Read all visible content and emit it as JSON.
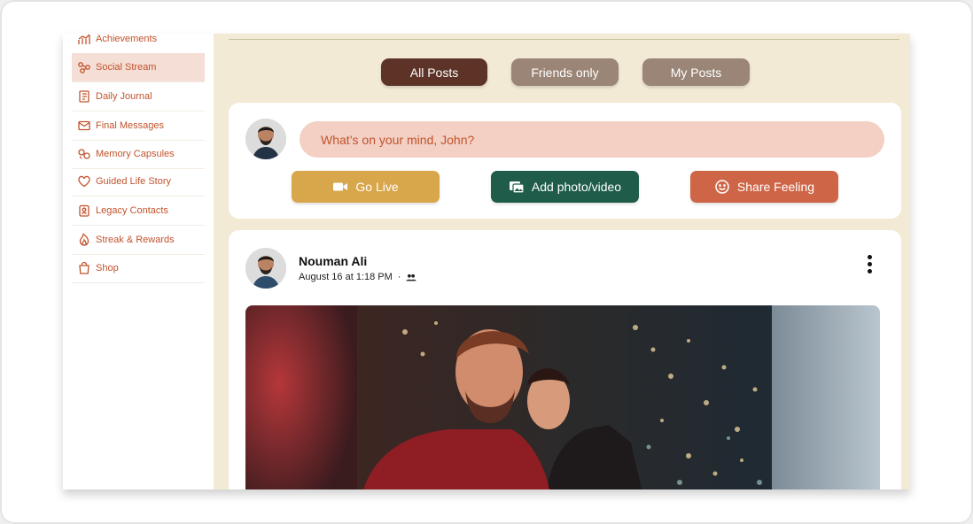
{
  "sidebar": {
    "items": [
      {
        "label": "Achievements",
        "icon": "chart-icon",
        "active": false
      },
      {
        "label": "Social Stream",
        "icon": "network-icon",
        "active": true
      },
      {
        "label": "Daily Journal",
        "icon": "journal-icon",
        "active": false
      },
      {
        "label": "Final Messages",
        "icon": "envelope-icon",
        "active": false
      },
      {
        "label": "Memory Capsules",
        "icon": "capsules-icon",
        "active": false
      },
      {
        "label": "Guided Life Story",
        "icon": "heart-icon",
        "active": false
      },
      {
        "label": "Legacy Contacts",
        "icon": "contact-badge-icon",
        "active": false
      },
      {
        "label": "Streak & Rewards",
        "icon": "flame-icon",
        "active": false
      },
      {
        "label": "Shop",
        "icon": "shopping-bag-icon",
        "active": false
      }
    ]
  },
  "tabs": [
    {
      "label": "All Posts",
      "active": true
    },
    {
      "label": "Friends only",
      "active": false
    },
    {
      "label": "My Posts",
      "active": false
    }
  ],
  "composer": {
    "placeholder": "What’s on your mind, John?",
    "actions": [
      {
        "label": "Go Live",
        "icon": "video-camera-icon",
        "color": "#d8a64b"
      },
      {
        "label": "Add photo/video",
        "icon": "photos-icon",
        "color": "#1f5c4a"
      },
      {
        "label": "Share Feeling",
        "icon": "smiley-icon",
        "color": "#cf6547"
      }
    ]
  },
  "post": {
    "author": "Nouman Ali",
    "timestamp": "August 16 at 1:18 PM",
    "separator": "·",
    "audience_icon": "friends-icon"
  },
  "colors": {
    "accent": "#c2532d",
    "background": "#f3ead6",
    "active_tab": "#5c3326",
    "inactive_tab": "#9a8576"
  }
}
